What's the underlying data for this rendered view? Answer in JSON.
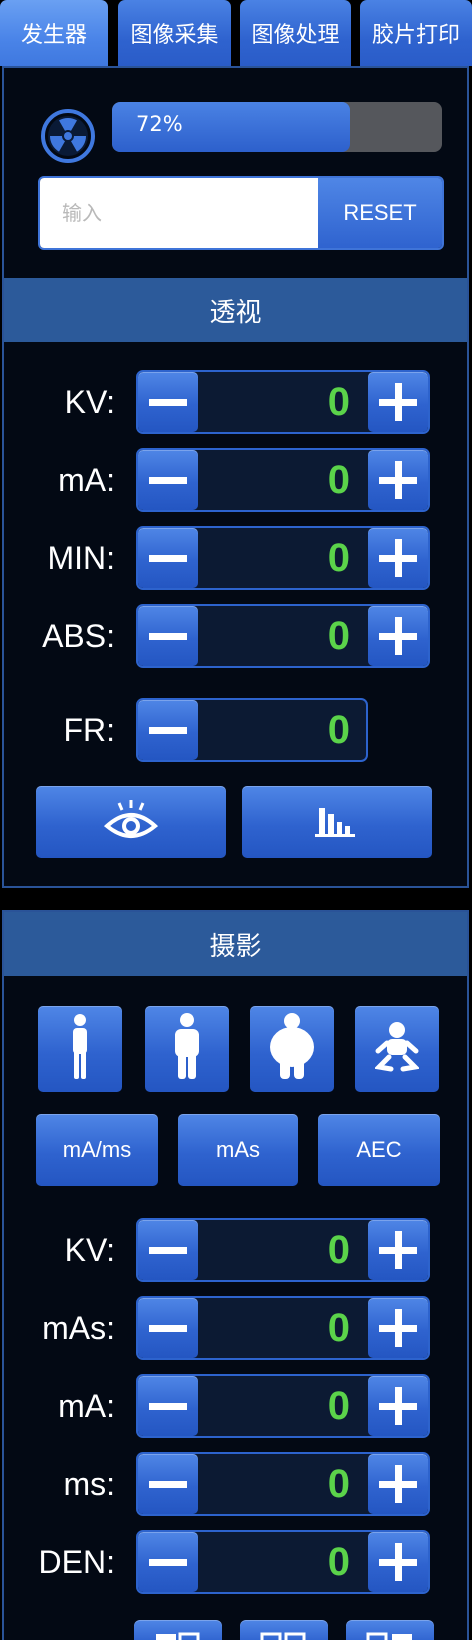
{
  "tabs": [
    {
      "label": "发生器",
      "active": true
    },
    {
      "label": "图像采集",
      "active": false
    },
    {
      "label": "图像处理",
      "active": false
    },
    {
      "label": "胶片打印",
      "active": false
    }
  ],
  "generator": {
    "progress": {
      "value": 72,
      "text": "72%"
    },
    "input": {
      "placeholder": "输入",
      "value": ""
    },
    "reset_label": "RESET"
  },
  "fluoroscopy": {
    "title": "透视",
    "params": [
      {
        "label": "KV:",
        "value": "0"
      },
      {
        "label": "mA:",
        "value": "0"
      },
      {
        "label": "MIN:",
        "value": "0"
      },
      {
        "label": "ABS:",
        "value": "0"
      },
      {
        "label": "FR:",
        "value": "0"
      }
    ],
    "actions": [
      "eye-icon",
      "waveform-icon"
    ]
  },
  "radiography": {
    "title": "摄影",
    "body_types": [
      "slim-body-icon",
      "normal-body-icon",
      "large-body-icon",
      "infant-body-icon"
    ],
    "modes": [
      "mA/ms",
      "mAs",
      "AEC"
    ],
    "params": [
      {
        "label": "KV:",
        "value": "0"
      },
      {
        "label": "mAs:",
        "value": "0"
      },
      {
        "label": "mA:",
        "value": "0"
      },
      {
        "label": "ms:",
        "value": "0"
      },
      {
        "label": "DEN:",
        "value": "0"
      }
    ]
  },
  "colors": {
    "accent": "#2f63cf",
    "value_green": "#5bd34a",
    "panel_bg": "#030914",
    "header_bg": "#2c5a9a"
  }
}
